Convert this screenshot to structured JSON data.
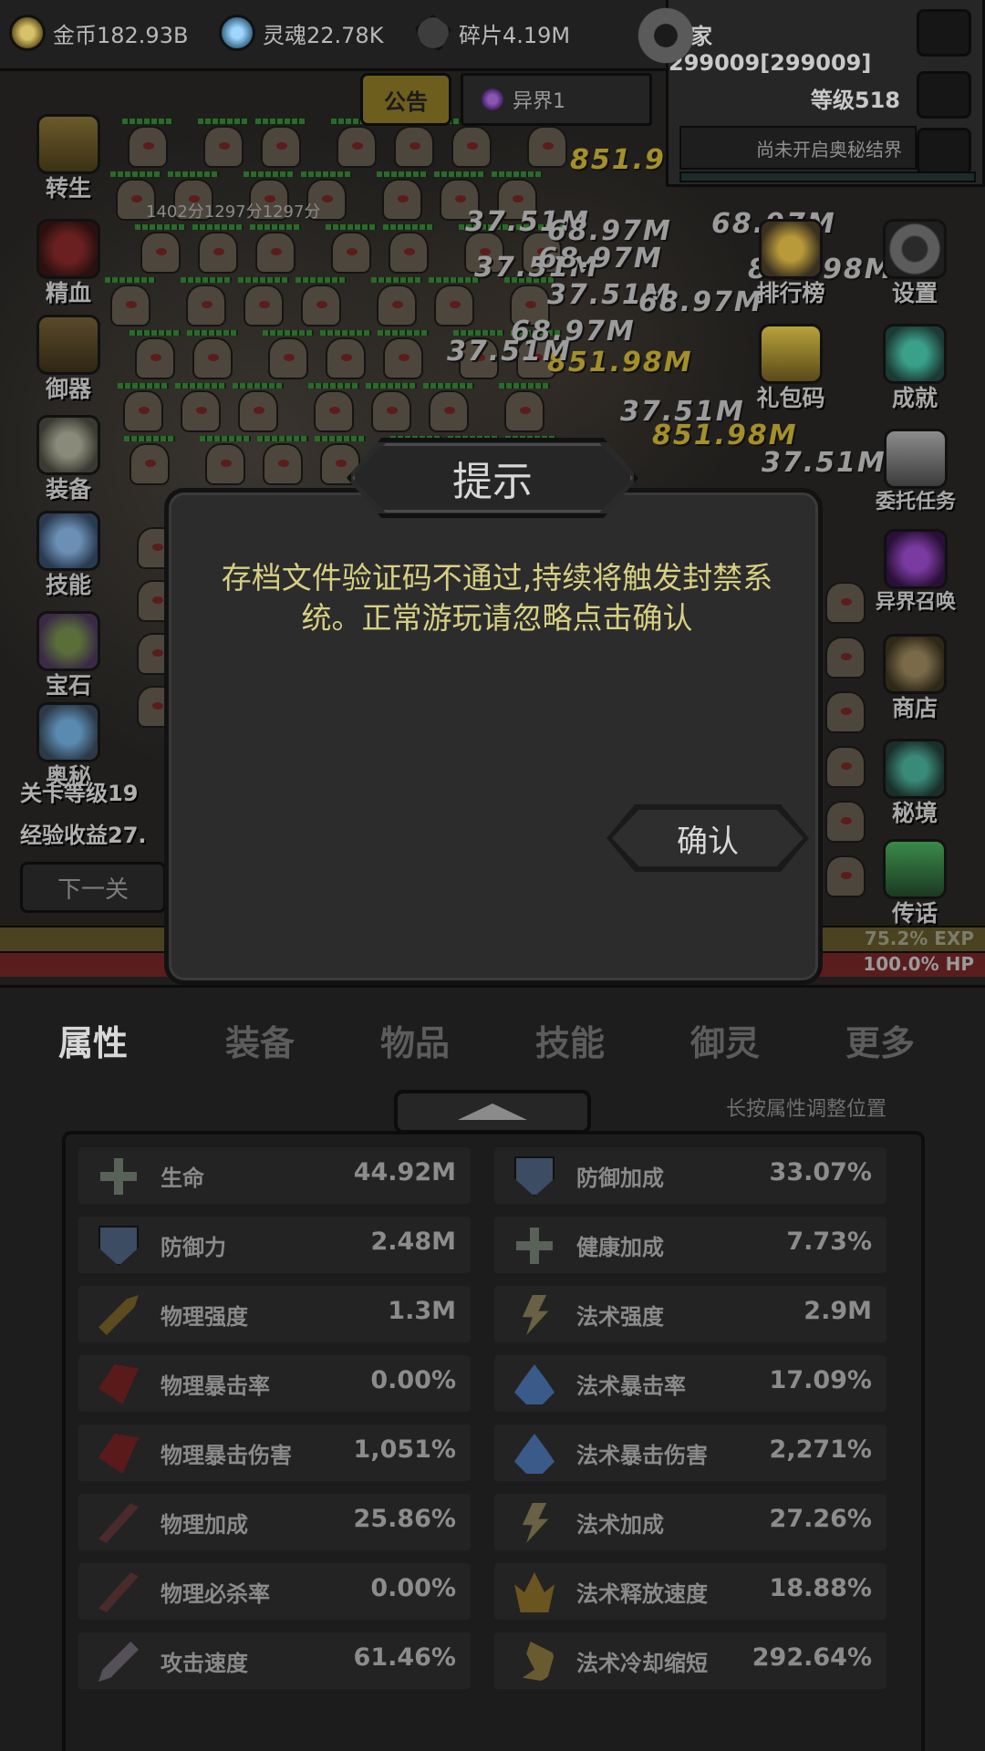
{
  "topbar": {
    "gold": "金币182.93B",
    "soul": "灵魂22.78K",
    "fragment": "碎片4.19M"
  },
  "player": {
    "name": "玩家299009[299009]",
    "level": "等级518",
    "secret_realm": "尚未开启奥秘结界"
  },
  "notice_label": "公告",
  "realm_label": "异界1",
  "battle": {
    "timer_text": "1402分1297分1297分",
    "damage_numbers": [
      "851.9",
      "37.51M",
      "68.97M",
      "37.51M",
      "68.97M",
      "37.51M",
      "68.97M",
      "68.97M",
      "851.98M",
      "37.51M",
      "851.98M",
      "37.51M",
      "37.51M",
      "68.97M",
      "851.98M"
    ]
  },
  "left_menu": [
    "转生",
    "精血",
    "御器",
    "装备",
    "技能",
    "宝石",
    "奥秘"
  ],
  "right_menu": [
    "设置",
    "排行榜",
    "成就",
    "礼包码",
    "委托任务",
    "异界召唤",
    "商店",
    "秘境",
    "传话"
  ],
  "stage": {
    "stage_level": "关卡等级19",
    "exp_income": "经验收益27.",
    "next_label": "下一关"
  },
  "exp_text": "75.2% EXP",
  "hp_text": "100.0% HP",
  "dialog": {
    "title": "提示",
    "message": "存档文件验证码不通过,持续将触发封禁系统。正常游玩请忽略点击确认",
    "confirm": "确认"
  },
  "tabs": [
    "属性",
    "装备",
    "物品",
    "技能",
    "御灵",
    "更多"
  ],
  "attr_hint": "长按属性调整位置",
  "attributes_left": [
    {
      "name": "生命",
      "value": "44.92M",
      "icon": "health-plus-icon"
    },
    {
      "name": "防御力",
      "value": "2.48M",
      "icon": "shield-icon"
    },
    {
      "name": "物理强度",
      "value": "1.3M",
      "icon": "arrow-icon"
    },
    {
      "name": "物理暴击率",
      "value": "0.00%",
      "icon": "claw-icon"
    },
    {
      "name": "物理暴击伤害",
      "value": "1,051%",
      "icon": "claw-icon"
    },
    {
      "name": "物理加成",
      "value": "25.86%",
      "icon": "slash-icon"
    },
    {
      "name": "物理必杀率",
      "value": "0.00%",
      "icon": "slash-icon"
    },
    {
      "name": "攻击速度",
      "value": "61.46%",
      "icon": "sword-icon"
    }
  ],
  "attributes_right": [
    {
      "name": "防御加成",
      "value": "33.07%",
      "icon": "shield-icon"
    },
    {
      "name": "健康加成",
      "value": "7.73%",
      "icon": "health-plus-icon"
    },
    {
      "name": "法术强度",
      "value": "2.9M",
      "icon": "bolt-icon"
    },
    {
      "name": "法术暴击率",
      "value": "17.09%",
      "icon": "flame-icon"
    },
    {
      "name": "法术暴击伤害",
      "value": "2,271%",
      "icon": "flame-icon"
    },
    {
      "name": "法术加成",
      "value": "27.26%",
      "icon": "bolt-icon"
    },
    {
      "name": "法术释放速度",
      "value": "18.88%",
      "icon": "crown-icon"
    },
    {
      "name": "法术冷却缩短",
      "value": "292.64%",
      "icon": "swirl-icon"
    }
  ],
  "colors": {
    "message_text": "#d7cf83",
    "tab_active_border": "#5a4e1c",
    "exp_bar": "#4a4220",
    "hp_bar": "#5a1d1d"
  }
}
